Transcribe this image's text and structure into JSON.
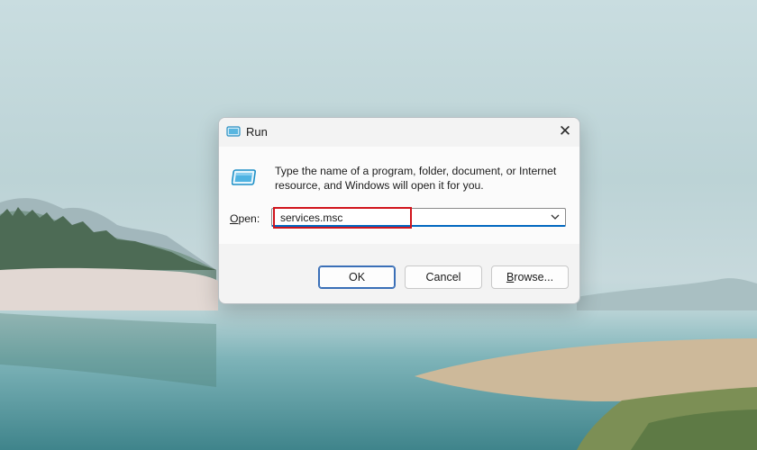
{
  "dialog": {
    "title": "Run",
    "description": "Type the name of a program, folder, document, or Internet resource, and Windows will open it for you.",
    "open_label_prefix": "O",
    "open_label_rest": "pen:",
    "open_value": "services.msc",
    "buttons": {
      "ok": "OK",
      "cancel": "Cancel",
      "browse": "Browse..."
    }
  },
  "icons": {
    "app": "run-app-icon",
    "close": "close-icon",
    "dropdown": "chevron-down-icon"
  },
  "colors": {
    "highlight": "#d0141c",
    "accent": "#0067c0"
  }
}
